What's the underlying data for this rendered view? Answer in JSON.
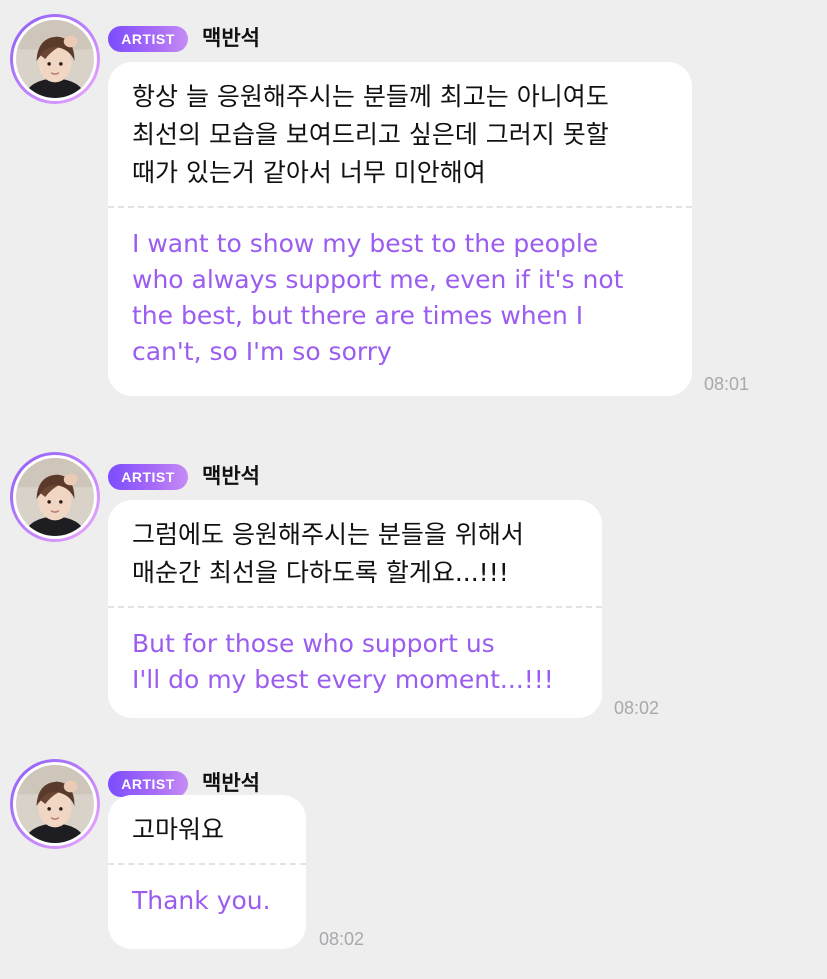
{
  "messages": [
    {
      "badge": "ARTIST",
      "sender": "맥반석",
      "korean": "항상 늘 응원해주시는 분들께 최고는 아니여도\n최선의 모습을 보여드리고 싶은데 그러지 못할\n때가 있는거 같아서 너무 미안해여",
      "english": "I want to show my best to the people\nwho always support me, even if it's not\nthe best, but there are times when I\ncan't, so I'm so sorry",
      "time": "08:01"
    },
    {
      "badge": "ARTIST",
      "sender": "맥반석",
      "korean": "그럼에도 응원해주시는 분들을 위해서\n매순간 최선을 다하도록 할게요...!!!",
      "english": "But for those who support us\nI'll do my best every moment...!!!",
      "time": "08:02"
    },
    {
      "badge": "ARTIST",
      "sender": "맥반석",
      "korean": "고마워요",
      "english": "Thank you.",
      "time": "08:02"
    }
  ],
  "colors": {
    "background": "#eeeeef",
    "bubble": "#ffffff",
    "translation_text": "#9b5cf0",
    "badge_gradient_start": "#7c4dff",
    "badge_gradient_end": "#c58cf5",
    "timestamp": "#a9a9ad"
  },
  "icons": {
    "avatar": "artist-profile-photo"
  }
}
